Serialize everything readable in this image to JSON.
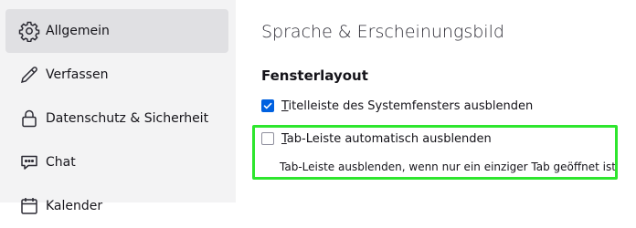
{
  "sidebar": {
    "items": [
      {
        "label": "Allgemein",
        "icon": "gear-icon",
        "selected": true
      },
      {
        "label": "Verfassen",
        "icon": "pencil-icon",
        "selected": false
      },
      {
        "label": "Datenschutz & Sicherheit",
        "icon": "lock-icon",
        "selected": false
      },
      {
        "label": "Chat",
        "icon": "chat-bubble-icon",
        "selected": false
      },
      {
        "label": "Kalender",
        "icon": "calendar-icon",
        "selected": false
      }
    ]
  },
  "main": {
    "section_title": "Sprache & Erscheinungsbild",
    "group_title": "Fensterlayout",
    "options": [
      {
        "access_key": "T",
        "label_rest": "itelleiste des Systemfensters ausblenden",
        "checked": true
      },
      {
        "access_key": "T",
        "label_rest": "ab-Leiste automatisch ausblenden",
        "checked": false,
        "description": "Tab-Leiste ausblenden, wenn nur ein einziger Tab geöffnet ist"
      }
    ]
  },
  "colors": {
    "accent": "#0061e0",
    "highlight": "#2ee62e",
    "sidebar_bg": "#f3f3f4",
    "selected_bg": "#e0e0e3"
  }
}
